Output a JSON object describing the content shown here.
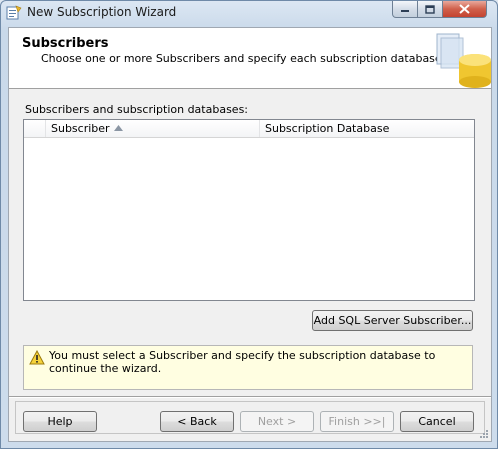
{
  "window": {
    "title": "New Subscription Wizard"
  },
  "header": {
    "title": "Subscribers",
    "description": "Choose one or more Subscribers and specify each subscription database."
  },
  "subscribers": {
    "section_label": "Subscribers and subscription databases:",
    "columns": [
      "Subscriber",
      "Subscription Database"
    ],
    "sorted_column": "Subscriber",
    "sort_direction": "ascending",
    "rows": []
  },
  "add_button_label": "Add SQL Server Subscriber...",
  "message": {
    "icon": "warning-icon",
    "text": "You must select a Subscriber and specify the subscription database to continue the wizard."
  },
  "footer": {
    "help_label": "Help",
    "back_label": "< Back",
    "next_label": "Next >",
    "finish_label": "Finish >>|",
    "cancel_label": "Cancel"
  },
  "colors": {
    "title_bar": "#dce7f3",
    "close_button": "#c44330",
    "dialog_background": "#f0f0f0",
    "message_background": "#fffee1"
  }
}
